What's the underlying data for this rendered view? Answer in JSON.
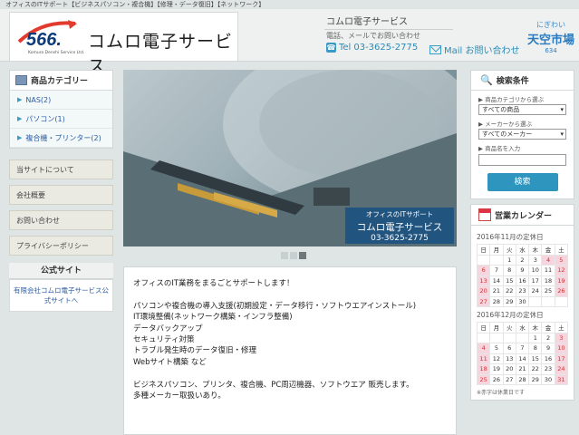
{
  "topbar": {
    "text": "オフィスのITサポート【ビジネスパソコン・複合機】【修理・データ復旧】【ネットワーク】"
  },
  "logo": {
    "number": "566.",
    "subtitle": "Komuro Denshi Service Ltd.",
    "name": "コムロ電子サービス"
  },
  "header": {
    "title": "コムロ電子サービス",
    "subtitle": "電話、メールでお問い合わせ",
    "tel_label": "Tel",
    "tel_number": "03-3625-2775",
    "mail_label": "Mail お問い合わせ"
  },
  "tenku": {
    "line1": "にぎわい",
    "line2": "天空市場",
    "line3": "634"
  },
  "categories": {
    "title": "商品カテゴリー",
    "items": [
      {
        "label": "NAS(2)"
      },
      {
        "label": "パソコン(1)"
      },
      {
        "label": "複合機・プリンター(2)"
      }
    ]
  },
  "left_links": [
    {
      "label": "当サイトについて"
    },
    {
      "label": "会社概要"
    },
    {
      "label": "お問い合わせ"
    },
    {
      "label": "プライバシーポリシー"
    }
  ],
  "official": {
    "title": "公式サイト",
    "link": "有限会社コムロ電子サービス公式サイトへ"
  },
  "hero": {
    "overlay_top": "オフィスのITサポート",
    "overlay_name": "コムロ電子サービス",
    "overlay_tel": "03-3625-2775"
  },
  "content": {
    "lines": [
      "オフィスのIT業務をまるごとサポートします！",
      "",
      "パソコンや複合機の導入支援(初期設定・データ移行・ソフトウエアインストール)",
      "IT環境整備(ネットワーク構築・インフラ整備)",
      "データバックアップ",
      "セキュリティ対策",
      "トラブル発生時のデータ復旧・修理",
      "Webサイト構築 など",
      "",
      "ビジネスパソコン、プリンタ、複合機、PC周辺機器、ソフトウエア 販売します。",
      "多種メーカー取扱いあり。"
    ]
  },
  "search": {
    "title": "検索条件",
    "category_label": "商品カテゴリから選ぶ",
    "category_value": "すべての商品",
    "maker_label": "メーカーから選ぶ",
    "maker_value": "すべてのメーカー",
    "name_label": "商品名を入力",
    "button": "検索"
  },
  "calendar": {
    "title": "営業カレンダー",
    "note": "※赤字は休業日です",
    "months": [
      {
        "title": "2016年11月の定休日",
        "days": [
          "日",
          "月",
          "火",
          "水",
          "木",
          "金",
          "土"
        ],
        "rows": [
          [
            "",
            "",
            "1",
            "2",
            "3",
            "4",
            "5"
          ],
          [
            "6",
            "7",
            "8",
            "9",
            "10",
            "11",
            "12"
          ],
          [
            "13",
            "14",
            "15",
            "16",
            "17",
            "18",
            "19"
          ],
          [
            "20",
            "21",
            "22",
            "23",
            "24",
            "25",
            "26"
          ],
          [
            "27",
            "28",
            "29",
            "30",
            "",
            "",
            ""
          ]
        ],
        "holidays": [
          [
            0,
            5
          ],
          [
            0,
            6
          ],
          [
            1,
            0
          ],
          [
            1,
            6
          ],
          [
            2,
            0
          ],
          [
            2,
            6
          ],
          [
            3,
            0
          ],
          [
            3,
            6
          ],
          [
            4,
            0
          ]
        ]
      },
      {
        "title": "2016年12月の定休日",
        "days": [
          "日",
          "月",
          "火",
          "水",
          "木",
          "金",
          "土"
        ],
        "rows": [
          [
            "",
            "",
            "",
            "",
            "1",
            "2",
            "3"
          ],
          [
            "4",
            "5",
            "6",
            "7",
            "8",
            "9",
            "10"
          ],
          [
            "11",
            "12",
            "13",
            "14",
            "15",
            "16",
            "17"
          ],
          [
            "18",
            "19",
            "20",
            "21",
            "22",
            "23",
            "24"
          ],
          [
            "25",
            "26",
            "27",
            "28",
            "29",
            "30",
            "31"
          ]
        ],
        "holidays": [
          [
            0,
            6
          ],
          [
            1,
            0
          ],
          [
            1,
            6
          ],
          [
            2,
            0
          ],
          [
            2,
            6
          ],
          [
            3,
            0
          ],
          [
            3,
            6
          ],
          [
            4,
            0
          ],
          [
            4,
            6
          ]
        ]
      }
    ]
  }
}
